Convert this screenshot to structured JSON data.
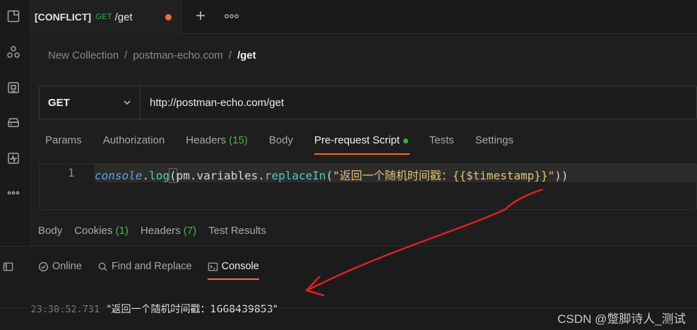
{
  "sidebar": {
    "icons": [
      "collections-icon",
      "apis-icon",
      "environments-icon",
      "mock-servers-icon",
      "monitors-icon",
      "more-icon"
    ]
  },
  "tab": {
    "conflict": "[CONFLICT]",
    "method": "GET",
    "name": "/get"
  },
  "breadcrumb": {
    "collection": "New Collection",
    "folder": "postman-echo.com",
    "request": "/get",
    "separator": "/"
  },
  "request": {
    "method": "GET",
    "url": "http://postman-echo.com/get"
  },
  "request_tabs": [
    {
      "label": "Params"
    },
    {
      "label": "Authorization"
    },
    {
      "label": "Headers",
      "count": "(15)"
    },
    {
      "label": "Body"
    },
    {
      "label": "Pre-request Script"
    },
    {
      "label": "Tests"
    },
    {
      "label": "Settings"
    }
  ],
  "editor": {
    "line_number": "1",
    "tokens": {
      "obj": "console",
      "dot1": ".",
      "fn1": "log",
      "open": "(",
      "plain": "pm.variables.",
      "fn2": "replaceIn",
      "paren": "(",
      "str": "\"返回一个随机时间戳：{{$timestamp}}\"",
      "close": "))"
    }
  },
  "response_tabs": [
    {
      "label": "Body"
    },
    {
      "label": "Cookies",
      "count": "(1)"
    },
    {
      "label": "Headers",
      "count": "(7)"
    },
    {
      "label": "Test Results"
    }
  ],
  "bottom_toolbar": {
    "online": "Online",
    "find_replace": "Find and Replace",
    "console": "Console"
  },
  "console_log": {
    "timestamp": "23:30:52.731",
    "message": "\"返回一个随机时间戳：1668439853\""
  },
  "watermark": "CSDN @蹩脚诗人_测试",
  "colors": {
    "accent": "#f26b3a",
    "green": "#2fb24c",
    "annotation_arrow": "#e02020"
  }
}
